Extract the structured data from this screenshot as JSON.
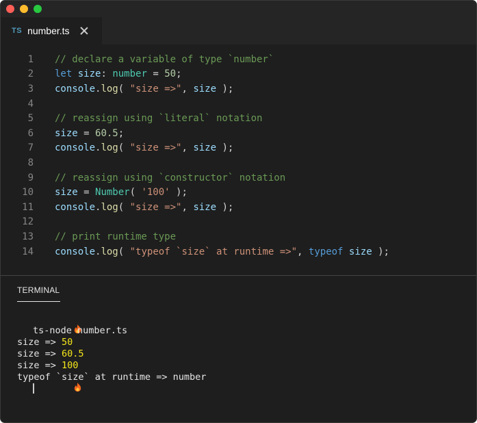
{
  "window": {
    "tab": {
      "badge": "TS",
      "title": "number.ts"
    }
  },
  "editor": {
    "lines": [
      {
        "n": "1"
      },
      {
        "n": "2"
      },
      {
        "n": "3"
      },
      {
        "n": "4"
      },
      {
        "n": "5"
      },
      {
        "n": "6"
      },
      {
        "n": "7"
      },
      {
        "n": "8"
      },
      {
        "n": "9"
      },
      {
        "n": "10"
      },
      {
        "n": "11"
      },
      {
        "n": "12"
      },
      {
        "n": "13"
      },
      {
        "n": "14"
      }
    ],
    "code": {
      "l1": "// declare a variable of type `number`",
      "l2": {
        "kw": "let",
        "var": "size",
        "colon": ":",
        "type": "number",
        "eq": " = ",
        "num": "50",
        "end": ";"
      },
      "l3": {
        "obj": "console",
        "dot": ".",
        "fn": "log",
        "open": "( ",
        "str": "\"size =>\"",
        "comma": ", ",
        "var": "size",
        "close": " );"
      },
      "l5": "// reassign using `literal` notation",
      "l6": {
        "var": "size",
        "eq": " = ",
        "num": "60.5",
        "end": ";"
      },
      "l7": {
        "obj": "console",
        "dot": ".",
        "fn": "log",
        "open": "( ",
        "str": "\"size =>\"",
        "comma": ", ",
        "var": "size",
        "close": " );"
      },
      "l9": "// reassign using `constructor` notation",
      "l10": {
        "var": "size",
        "eq": " = ",
        "ctor": "Number",
        "open": "( ",
        "str": "'100'",
        "close": " );"
      },
      "l11": {
        "obj": "console",
        "dot": ".",
        "fn": "log",
        "open": "( ",
        "str": "\"size =>\"",
        "comma": ", ",
        "var": "size",
        "close": " );"
      },
      "l13": "// print runtime type",
      "l14": {
        "obj": "console",
        "dot": ".",
        "fn": "log",
        "open": "( ",
        "str": "\"typeof `size` at runtime =>\"",
        "comma": ", ",
        "kw": "typeof",
        "sp": " ",
        "var": "size",
        "close": " );"
      }
    }
  },
  "terminal": {
    "tab_label": "TERMINAL",
    "command": "ts-node number.ts",
    "prompt_icon": "flame-icon",
    "output": [
      {
        "label": "size => ",
        "value": "50"
      },
      {
        "label": "size => ",
        "value": "60.5"
      },
      {
        "label": "size => ",
        "value": "100"
      },
      {
        "label": "typeof `size` at runtime => number",
        "value": ""
      }
    ]
  },
  "colors": {
    "background": "#1e1e1e",
    "comment": "#6a9955",
    "keyword": "#569cd6",
    "variable": "#9cdcfe",
    "type": "#4ec9b0",
    "number": "#b5cea8",
    "string": "#ce9178",
    "function": "#dcdcaa",
    "terminal_value": "#f5e71a"
  }
}
